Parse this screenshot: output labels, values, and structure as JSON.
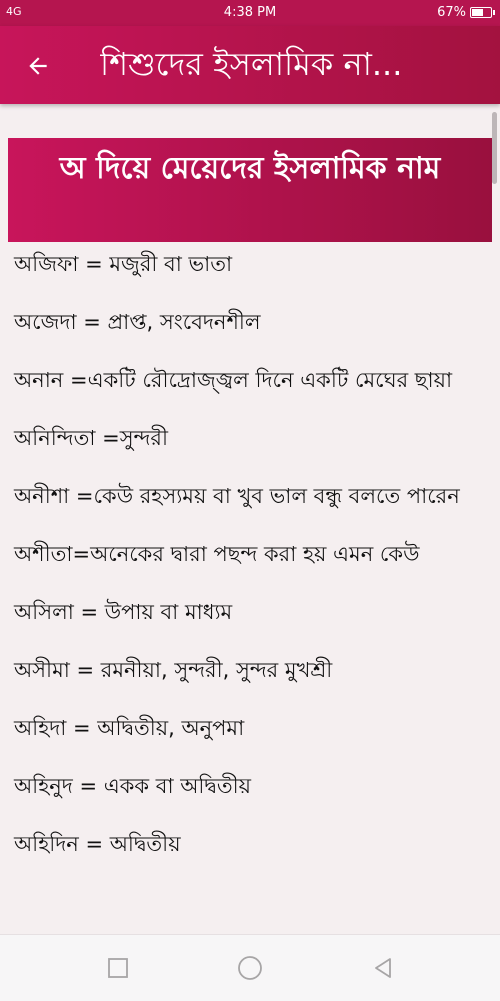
{
  "status_bar": {
    "signal": "4G",
    "time": "4:38 PM",
    "battery": "67%",
    "battery_level": 0.67
  },
  "app_bar": {
    "title": "শিশুদের ইসলামিক না...",
    "back_icon": "arrow-left-icon"
  },
  "header": {
    "title": "অ দিয়ে মেয়েদের ইসলামিক নাম"
  },
  "names": [
    "অজিফা = মজুরী বা ভাতা",
    " অজেদা = প্রাপ্ত, সংবেদনশীল",
    " অনান =একটি রৌদ্রোজ্জ্বল দিনে একটি মেঘের ছায়া",
    " অনিন্দিতা  =সুন্দরী",
    " অনীশা =কেউ রহস্যময় বা খুব ভাল বন্ধু বলতে পারেন",
    " অশীতা=অনেকের দ্বারা পছন্দ করা হয় এমন কেউ",
    "  অসিলা = উপায় বা মাধ্যম",
    " অসীমা = রমনীয়া, সুন্দরী, সুন্দর মুখশ্রী",
    " অহিদা = অদ্বিতীয়, অনুপমা",
    " অহিনুদ = একক বা অদ্বিতীয়",
    " অহিদিন = অদ্বিতীয়"
  ],
  "nav_bar": {
    "icons": [
      "recents-square-icon",
      "home-circle-icon",
      "back-triangle-icon"
    ]
  },
  "colors": {
    "accent": "#c8155b",
    "accent_dark": "#99103e"
  }
}
